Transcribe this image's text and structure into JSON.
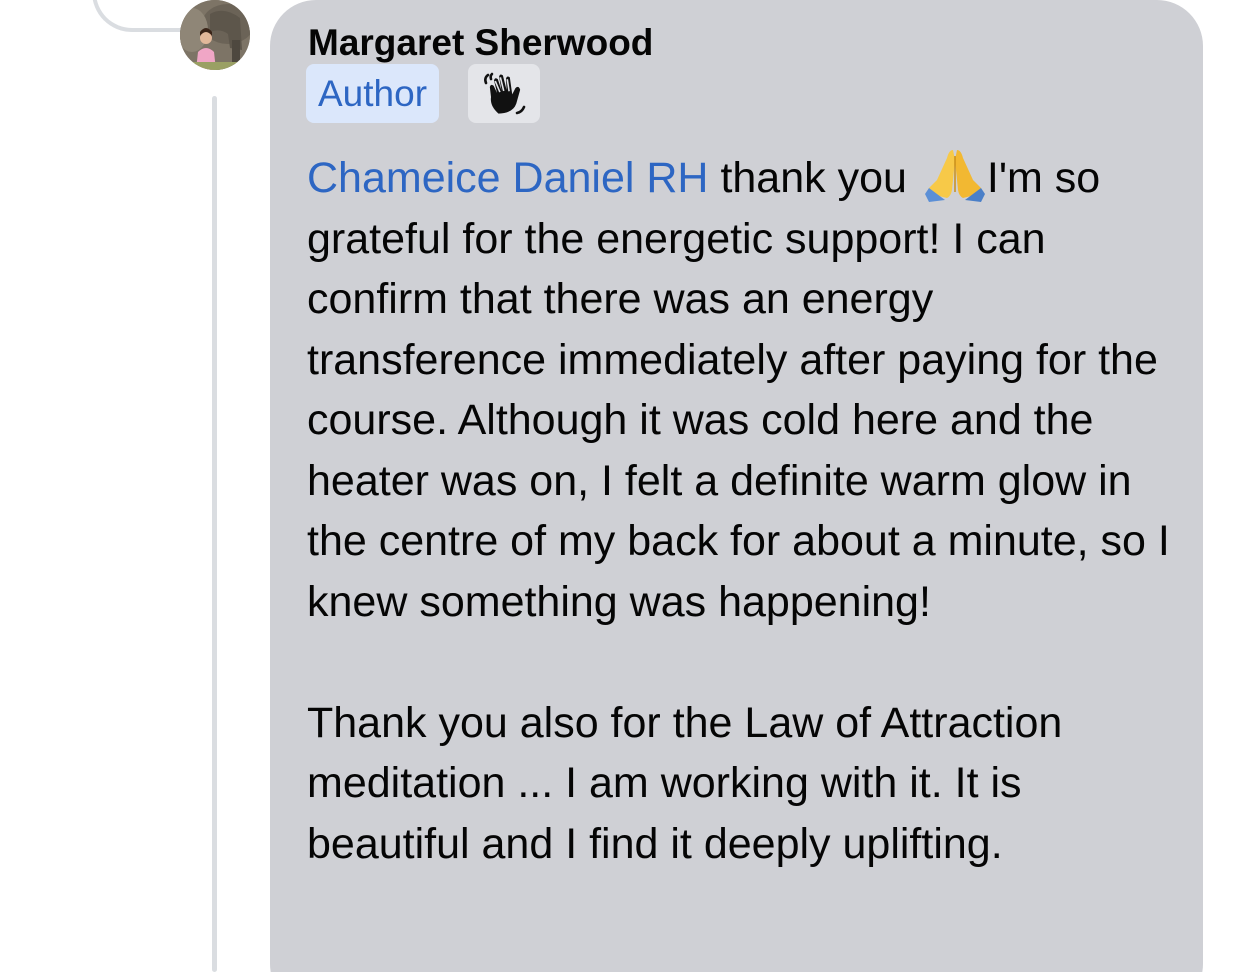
{
  "comment": {
    "author_name": "Margaret Sherwood",
    "author_badge": "Author",
    "avatar_icon": "profile-photo",
    "wave_badge_icon": "waving-hand-icon",
    "mention": "Chameice Daniel RH",
    "text_after_mention": " thank you ",
    "emoji_icon": "folded-hands-icon",
    "line1_rest": "I'm so grateful for the energetic support! I can confirm that there was an energy transference immediately after paying for the course. Although it was cold here and the heater was on, I felt a definite warm glow in the centre of my back for about a minute, so I knew something was happening!",
    "paragraph2": "Thank you also for the Law of Attraction meditation ... I am working with it. It is beautiful and I find it deeply uplifting."
  },
  "colors": {
    "bubble_bg": "#cfd0d5",
    "mention": "#2d66c3",
    "badge_bg": "#dbe7fb",
    "thread_line": "#dadde1"
  }
}
